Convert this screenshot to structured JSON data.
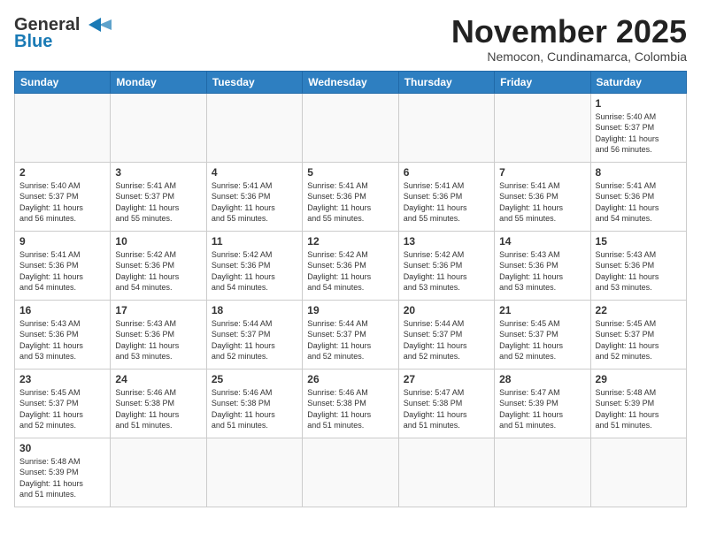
{
  "header": {
    "logo_line1": "General",
    "logo_line2": "Blue",
    "month_title": "November 2025",
    "subtitle": "Nemocon, Cundinamarca, Colombia"
  },
  "days_of_week": [
    "Sunday",
    "Monday",
    "Tuesday",
    "Wednesday",
    "Thursday",
    "Friday",
    "Saturday"
  ],
  "weeks": [
    [
      {
        "day": "",
        "info": ""
      },
      {
        "day": "",
        "info": ""
      },
      {
        "day": "",
        "info": ""
      },
      {
        "day": "",
        "info": ""
      },
      {
        "day": "",
        "info": ""
      },
      {
        "day": "",
        "info": ""
      },
      {
        "day": "1",
        "info": "Sunrise: 5:40 AM\nSunset: 5:37 PM\nDaylight: 11 hours\nand 56 minutes."
      }
    ],
    [
      {
        "day": "2",
        "info": "Sunrise: 5:40 AM\nSunset: 5:37 PM\nDaylight: 11 hours\nand 56 minutes."
      },
      {
        "day": "3",
        "info": "Sunrise: 5:41 AM\nSunset: 5:37 PM\nDaylight: 11 hours\nand 55 minutes."
      },
      {
        "day": "4",
        "info": "Sunrise: 5:41 AM\nSunset: 5:36 PM\nDaylight: 11 hours\nand 55 minutes."
      },
      {
        "day": "5",
        "info": "Sunrise: 5:41 AM\nSunset: 5:36 PM\nDaylight: 11 hours\nand 55 minutes."
      },
      {
        "day": "6",
        "info": "Sunrise: 5:41 AM\nSunset: 5:36 PM\nDaylight: 11 hours\nand 55 minutes."
      },
      {
        "day": "7",
        "info": "Sunrise: 5:41 AM\nSunset: 5:36 PM\nDaylight: 11 hours\nand 55 minutes."
      },
      {
        "day": "8",
        "info": "Sunrise: 5:41 AM\nSunset: 5:36 PM\nDaylight: 11 hours\nand 54 minutes."
      }
    ],
    [
      {
        "day": "9",
        "info": "Sunrise: 5:41 AM\nSunset: 5:36 PM\nDaylight: 11 hours\nand 54 minutes."
      },
      {
        "day": "10",
        "info": "Sunrise: 5:42 AM\nSunset: 5:36 PM\nDaylight: 11 hours\nand 54 minutes."
      },
      {
        "day": "11",
        "info": "Sunrise: 5:42 AM\nSunset: 5:36 PM\nDaylight: 11 hours\nand 54 minutes."
      },
      {
        "day": "12",
        "info": "Sunrise: 5:42 AM\nSunset: 5:36 PM\nDaylight: 11 hours\nand 54 minutes."
      },
      {
        "day": "13",
        "info": "Sunrise: 5:42 AM\nSunset: 5:36 PM\nDaylight: 11 hours\nand 53 minutes."
      },
      {
        "day": "14",
        "info": "Sunrise: 5:43 AM\nSunset: 5:36 PM\nDaylight: 11 hours\nand 53 minutes."
      },
      {
        "day": "15",
        "info": "Sunrise: 5:43 AM\nSunset: 5:36 PM\nDaylight: 11 hours\nand 53 minutes."
      }
    ],
    [
      {
        "day": "16",
        "info": "Sunrise: 5:43 AM\nSunset: 5:36 PM\nDaylight: 11 hours\nand 53 minutes."
      },
      {
        "day": "17",
        "info": "Sunrise: 5:43 AM\nSunset: 5:36 PM\nDaylight: 11 hours\nand 53 minutes."
      },
      {
        "day": "18",
        "info": "Sunrise: 5:44 AM\nSunset: 5:37 PM\nDaylight: 11 hours\nand 52 minutes."
      },
      {
        "day": "19",
        "info": "Sunrise: 5:44 AM\nSunset: 5:37 PM\nDaylight: 11 hours\nand 52 minutes."
      },
      {
        "day": "20",
        "info": "Sunrise: 5:44 AM\nSunset: 5:37 PM\nDaylight: 11 hours\nand 52 minutes."
      },
      {
        "day": "21",
        "info": "Sunrise: 5:45 AM\nSunset: 5:37 PM\nDaylight: 11 hours\nand 52 minutes."
      },
      {
        "day": "22",
        "info": "Sunrise: 5:45 AM\nSunset: 5:37 PM\nDaylight: 11 hours\nand 52 minutes."
      }
    ],
    [
      {
        "day": "23",
        "info": "Sunrise: 5:45 AM\nSunset: 5:37 PM\nDaylight: 11 hours\nand 52 minutes."
      },
      {
        "day": "24",
        "info": "Sunrise: 5:46 AM\nSunset: 5:38 PM\nDaylight: 11 hours\nand 51 minutes."
      },
      {
        "day": "25",
        "info": "Sunrise: 5:46 AM\nSunset: 5:38 PM\nDaylight: 11 hours\nand 51 minutes."
      },
      {
        "day": "26",
        "info": "Sunrise: 5:46 AM\nSunset: 5:38 PM\nDaylight: 11 hours\nand 51 minutes."
      },
      {
        "day": "27",
        "info": "Sunrise: 5:47 AM\nSunset: 5:38 PM\nDaylight: 11 hours\nand 51 minutes."
      },
      {
        "day": "28",
        "info": "Sunrise: 5:47 AM\nSunset: 5:39 PM\nDaylight: 11 hours\nand 51 minutes."
      },
      {
        "day": "29",
        "info": "Sunrise: 5:48 AM\nSunset: 5:39 PM\nDaylight: 11 hours\nand 51 minutes."
      }
    ],
    [
      {
        "day": "30",
        "info": "Sunrise: 5:48 AM\nSunset: 5:39 PM\nDaylight: 11 hours\nand 51 minutes."
      },
      {
        "day": "",
        "info": ""
      },
      {
        "day": "",
        "info": ""
      },
      {
        "day": "",
        "info": ""
      },
      {
        "day": "",
        "info": ""
      },
      {
        "day": "",
        "info": ""
      },
      {
        "day": "",
        "info": ""
      }
    ]
  ]
}
